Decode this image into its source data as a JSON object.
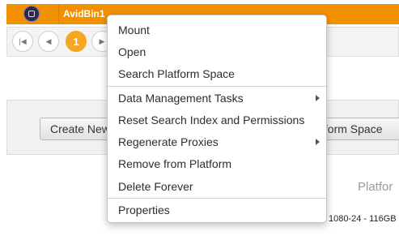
{
  "bin_list": {
    "rows": [
      {
        "icon": "avid-bin-icon",
        "name": "AvidBin1"
      }
    ]
  },
  "pager": {
    "first_icon": "first-page-icon",
    "prev_icon": "previous-page-icon",
    "current_page": "1",
    "next_icon": "next-page-icon"
  },
  "actions": {
    "create_label": "Create New",
    "search_label": "tform Space"
  },
  "platform_label": "Platfor",
  "storage_info": "1080-24 - 116GB",
  "context_menu": {
    "items": [
      {
        "label": "Mount"
      },
      {
        "label": "Open"
      },
      {
        "label": "Search Platform Space"
      },
      {
        "label": "Data Management Tasks",
        "submenu": true
      },
      {
        "label": "Reset Search Index and Permissions"
      },
      {
        "label": "Regenerate Proxies",
        "submenu": true
      },
      {
        "label": "Remove from Platform"
      },
      {
        "label": "Delete Forever"
      },
      {
        "label": "Properties"
      }
    ]
  },
  "colors": {
    "bin_row_bg": "#f29100",
    "current_page_bg": "#f5a623"
  }
}
